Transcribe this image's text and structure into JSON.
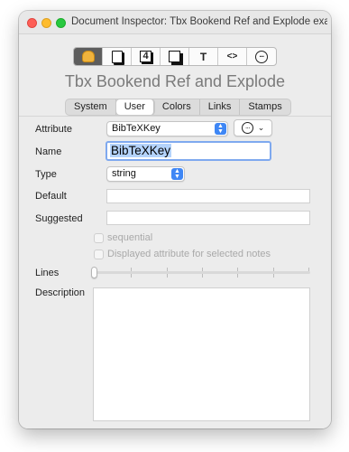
{
  "window": {
    "title": "Document Inspector: Tbx Bookend Ref and Explode example..."
  },
  "toolbar": {
    "buttons": [
      {
        "icon": "gloves-icon",
        "active": true
      },
      {
        "icon": "note-page-icon",
        "active": false
      },
      {
        "icon": "number-4-icon",
        "label": "4",
        "active": false
      },
      {
        "icon": "stacked-page-icon",
        "active": false
      },
      {
        "icon": "text-icon",
        "label": "T",
        "active": false
      },
      {
        "icon": "code-icon",
        "label": "<>",
        "active": false
      },
      {
        "icon": "more-circle-icon",
        "label": "···",
        "active": false
      }
    ]
  },
  "note_title": "Tbx Bookend Ref and Explode",
  "tabs": [
    {
      "label": "System",
      "selected": false
    },
    {
      "label": "User",
      "selected": true
    },
    {
      "label": "Colors",
      "selected": false
    },
    {
      "label": "Links",
      "selected": false
    },
    {
      "label": "Stamps",
      "selected": false
    }
  ],
  "form": {
    "attribute_label": "Attribute",
    "attribute_value": "BibTeXKey",
    "action_menu_icon": "···",
    "action_chevron": "⌄",
    "name_label": "Name",
    "name_value": "BibTeXKey",
    "type_label": "Type",
    "type_value": "string",
    "default_label": "Default",
    "default_value": "",
    "suggested_label": "Suggested",
    "suggested_value": "",
    "sequential_label": "sequential",
    "sequential_checked": false,
    "displayed_label": "Displayed attribute for selected notes",
    "displayed_checked": false,
    "lines_label": "Lines",
    "lines_level": 0,
    "description_label": "Description",
    "description_value": ""
  },
  "colors": {
    "accent": "#3f87f5",
    "selection": "#b4d3fb",
    "focus_ring": "#7fa9ef"
  }
}
